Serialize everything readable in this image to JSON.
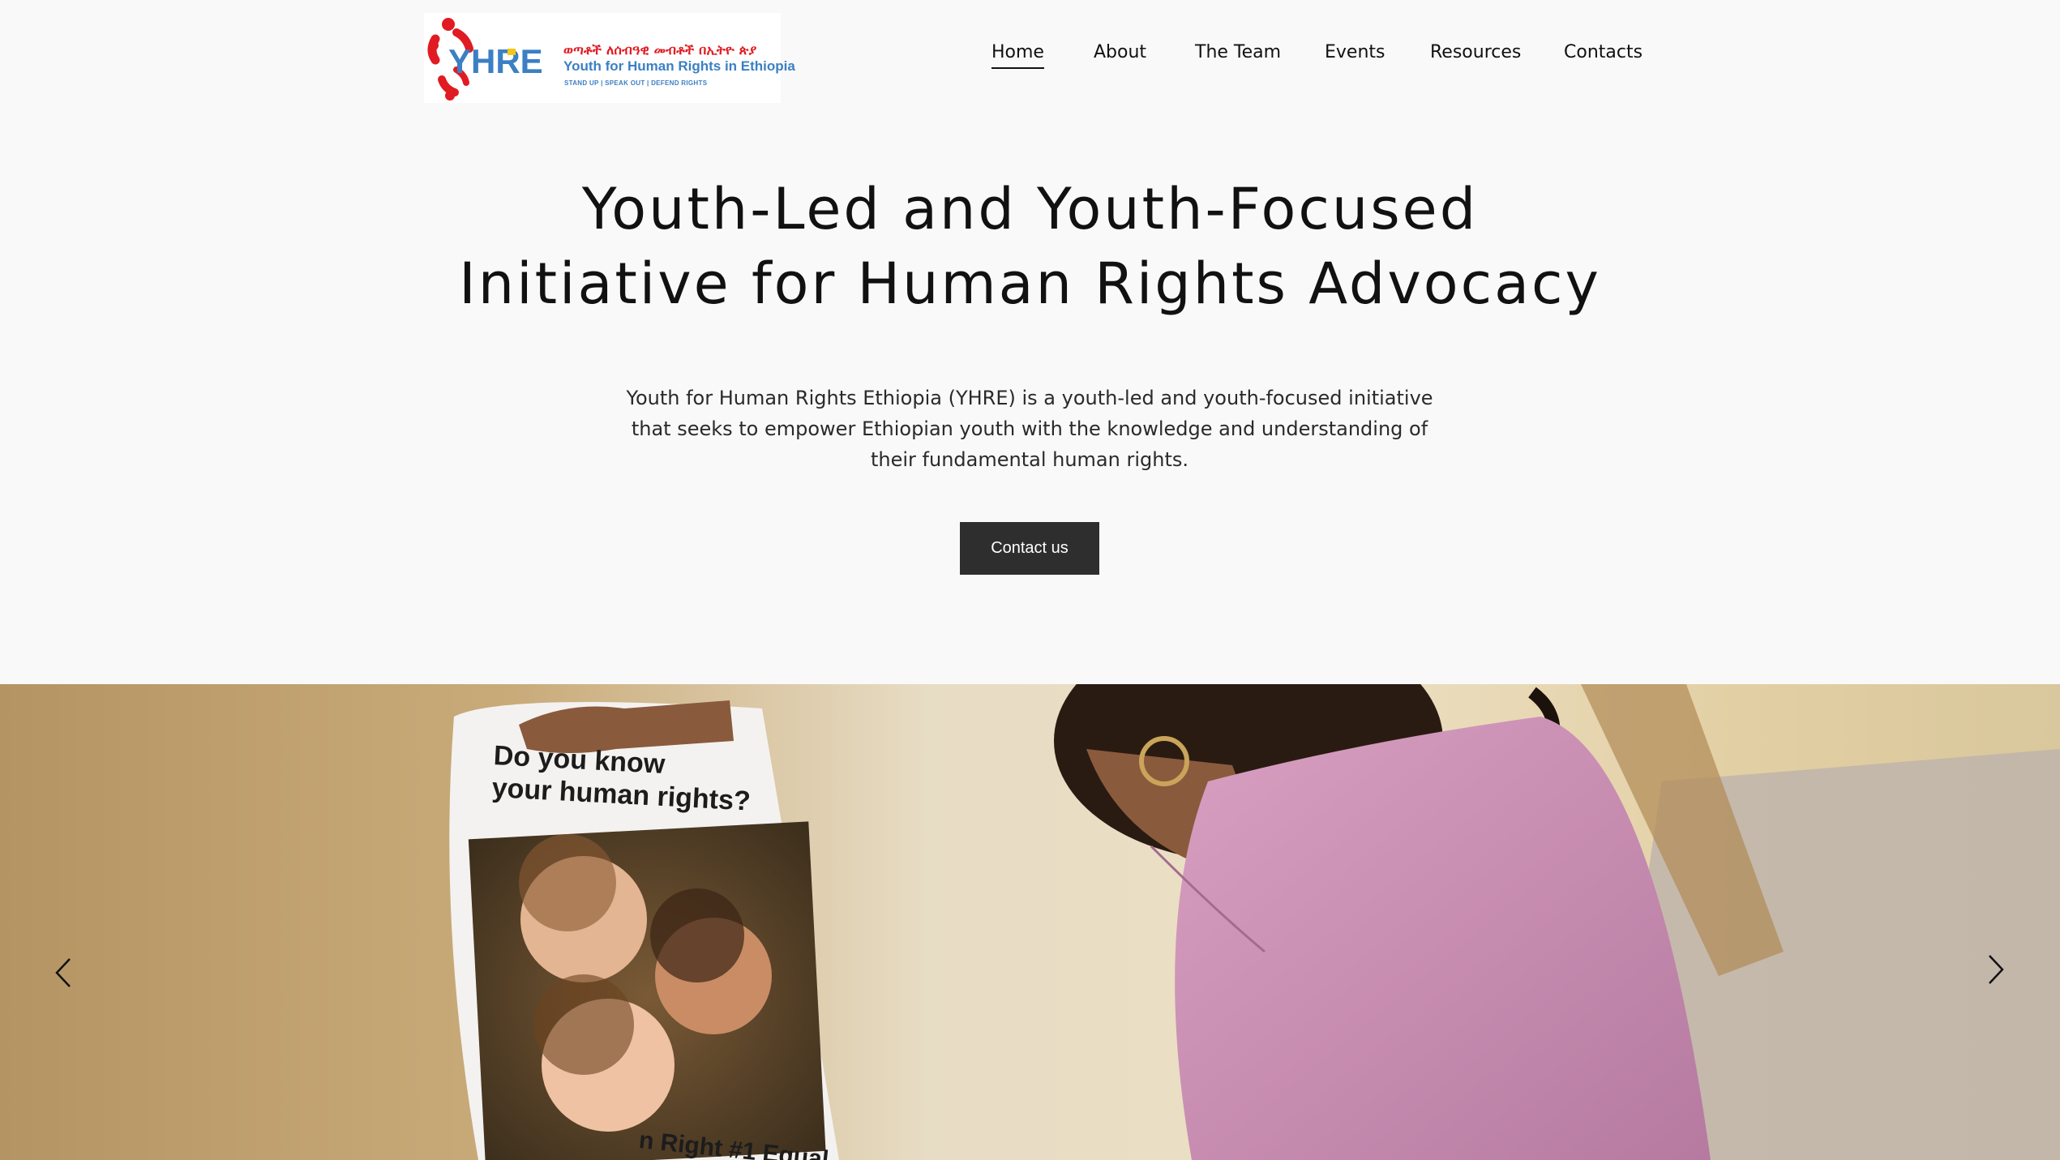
{
  "header": {
    "logo": {
      "mark_text": "YHRE",
      "amharic_text": "ወጣቶች ለሰብዓዊ መብቶች በኢትዮ ጵያ",
      "english_text": "Youth for Human Rights in Ethiopia",
      "tagline": "STAND UP | SPEAK OUT | DEFEND RIGHTS",
      "colors": {
        "red": "#e11b22",
        "blue": "#3b7fc4",
        "yellow": "#f5c518"
      }
    },
    "nav": [
      {
        "label": "Home",
        "active": true
      },
      {
        "label": "About",
        "active": false
      },
      {
        "label": "The Team",
        "active": false
      },
      {
        "label": "Events",
        "active": false
      },
      {
        "label": "Resources",
        "active": false
      },
      {
        "label": "Contacts",
        "active": false
      }
    ]
  },
  "hero": {
    "title_line1": "Youth-Led and Youth-Focused",
    "title_line2": "Initiative for Human Rights Advocacy",
    "description": "Youth for Human Rights Ethiopia (YHRE) is a youth-led and youth-focused initiative that seeks to empower Ethiopian youth with the knowledge and understanding of their fundamental human rights.",
    "cta_label": "Contact us"
  },
  "slideshow": {
    "poster_line1": "Do you know",
    "poster_line2": "your human rights?",
    "poster_bottom": "n Right #1   Equal",
    "prev_icon": "chevron-left-icon",
    "next_icon": "chevron-right-icon"
  }
}
